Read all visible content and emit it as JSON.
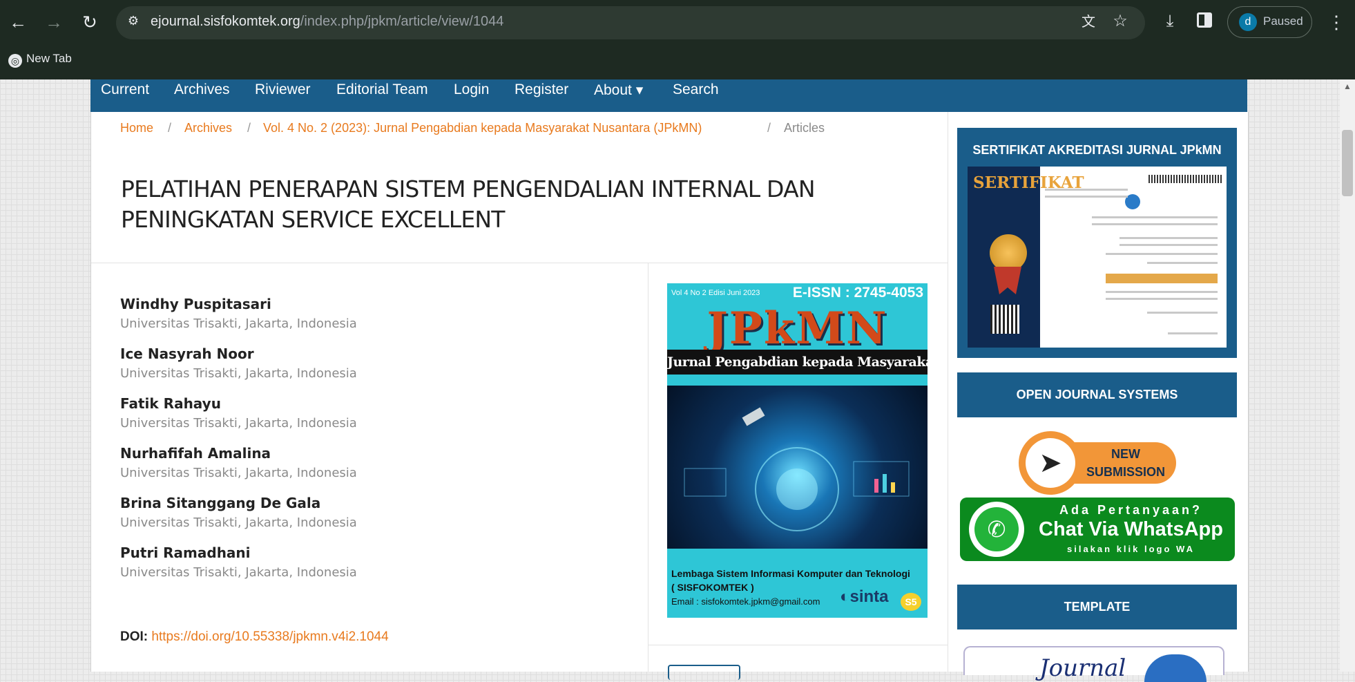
{
  "browser": {
    "url_host": "ejournal.sisfokomtek.org",
    "url_path": "/index.php/jpkm/article/view/1044",
    "profile_initial": "d",
    "profile_status": "Paused",
    "bookmark_newtab": "New Tab"
  },
  "nav": {
    "items": [
      "Current",
      "Archives",
      "Riviewer",
      "Editorial Team",
      "Login",
      "Register",
      "About ▾",
      "Search"
    ]
  },
  "breadcrumb": {
    "home": "Home",
    "archives": "Archives",
    "issue": "Vol. 4 No. 2 (2023): Jurnal Pengabdian kepada Masyarakat Nusantara (JPkMN)",
    "current": "Articles",
    "separator": "/"
  },
  "article": {
    "title": "PELATIHAN PENERAPAN SISTEM PENGENDALIAN INTERNAL DAN PENINGKATAN SERVICE EXCELLENT",
    "authors": [
      {
        "name": "Windhy Puspitasari",
        "affiliation": "Universitas Trisakti, Jakarta, Indonesia"
      },
      {
        "name": "Ice Nasyrah Noor",
        "affiliation": "Universitas Trisakti, Jakarta, Indonesia"
      },
      {
        "name": "Fatik Rahayu",
        "affiliation": "Universitas Trisakti, Jakarta, Indonesia"
      },
      {
        "name": "Nurhafifah Amalina",
        "affiliation": "Universitas Trisakti, Jakarta, Indonesia"
      },
      {
        "name": "Brina Sitanggang De Gala",
        "affiliation": "Universitas Trisakti, Jakarta, Indonesia"
      },
      {
        "name": "Putri Ramadhani",
        "affiliation": "Universitas Trisakti, Jakarta, Indonesia"
      }
    ],
    "doi_label": "DOI:",
    "doi_link": "https://doi.org/10.55338/jpkmn.v4i2.1044"
  },
  "cover": {
    "vol_text": "Vol 4 No 2 Edisi Juni 2023",
    "issn": "E-ISSN : 2745-4053",
    "logo": "JPkMN",
    "band": "Jurnal Pengabdian kepada Masyarakat Nusantara",
    "publisher": "Lembaga Sistem Informasi Komputer dan Teknologi",
    "publisher_abbr": "( SISFOKOMTEK )",
    "email": "Email : sisfokomtek.jpkm@gmail.com",
    "sinta": "sinta",
    "sinta_level": "S5"
  },
  "sidebar": {
    "cert_title": "SERTIFIKAT AKREDITASI JURNAL JPkMN",
    "cert_heading": "SERTIFIKAT",
    "ojs_title": "OPEN JOURNAL SYSTEMS",
    "new_submission_line1": "NEW",
    "new_submission_line2": "SUBMISSION",
    "wa_line1": "Ada Pertanyaan?",
    "wa_line2": "Chat Via WhatsApp",
    "wa_line3": "silakan klik logo WA",
    "template_title": "TEMPLATE",
    "template_img_text": "Journal"
  },
  "colors": {
    "nav_bg": "#1a5d8a",
    "accent_link": "#e87a1e",
    "chrome_bg": "#1e2a22"
  }
}
